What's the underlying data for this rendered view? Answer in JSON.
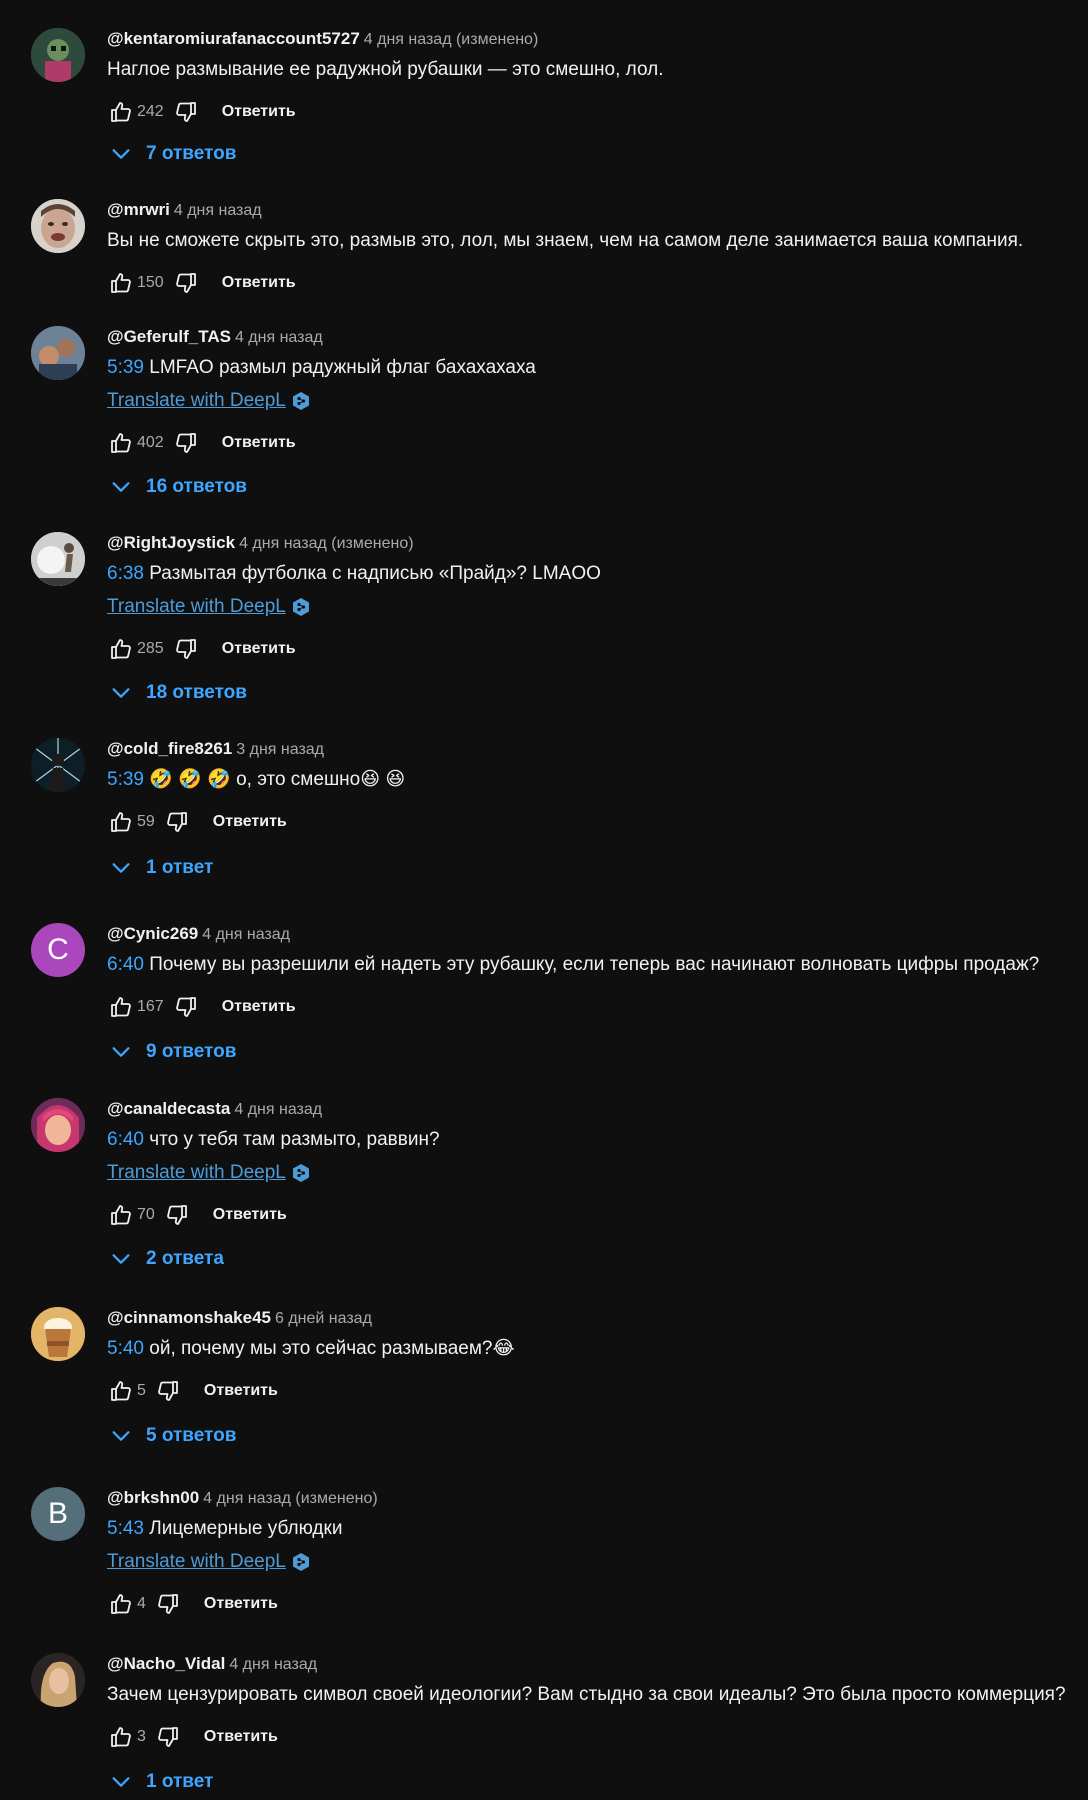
{
  "labels": {
    "reply": "Ответить",
    "translate": "Translate with DeepL"
  },
  "comments": [
    {
      "author": "@kentaromiurafanaccount5727",
      "meta": "4 дня назад (изменено)",
      "timestamp": "",
      "text": "Наглое размывание ее радужной рубашки — это смешно, лол.",
      "likes": "242",
      "replies": "7 ответов",
      "avatar": {
        "color": "#3b5e3a",
        "letter": "",
        "icon": "cartoon-avatar"
      }
    },
    {
      "author": "@mrwri",
      "meta": "4 дня назад",
      "timestamp": "",
      "text": "Вы не сможете скрыть это, размыв это, лол, мы знаем, чем на самом деле занимается ваша компания.",
      "likes": "150",
      "replies": "",
      "avatar": {
        "color": "#b59a8c",
        "letter": "",
        "icon": "face-avatar"
      }
    },
    {
      "author": "@Geferulf_TAS",
      "meta": "4 дня назад",
      "timestamp": "5:39",
      "text": "LMFAO размыл радужный флаг бахахахаха",
      "likes": "402",
      "replies": "16 ответов",
      "avatar": {
        "color": "#556a7e",
        "letter": "",
        "icon": "photo-avatar"
      }
    },
    {
      "author": "@RightJoystick",
      "meta": "4 дня назад (изменено)",
      "timestamp": "6:38",
      "text": "Размытая футболка с надписью «Прайд»? LMAOO",
      "likes": "285",
      "replies": "18 ответов",
      "avatar": {
        "color": "#9a9a9a",
        "letter": "",
        "icon": "figure-avatar"
      }
    },
    {
      "author": "@cold_fire8261",
      "meta": "3 дня назад",
      "timestamp": "5:39",
      "text": "🤣 🤣 🤣 о, это смешно😆 😆",
      "likes": "59",
      "replies": "1 ответ",
      "avatar": {
        "color": "#16303c",
        "letter": "",
        "icon": "dark-figure-avatar"
      }
    },
    {
      "author": "@Cynic269",
      "meta": "4 дня назад",
      "timestamp": "6:40",
      "text": "Почему вы разрешили ей надеть эту рубашку, если теперь вас начинают волновать цифры продаж?",
      "likes": "167",
      "replies": "9 ответов",
      "avatar": {
        "color": "#ab47bc",
        "letter": "C",
        "icon": "letter-avatar"
      }
    },
    {
      "author": "@canaldecasta",
      "meta": "4 дня назад",
      "timestamp": "6:40",
      "text": "что у тебя там размыто, раввин?",
      "likes": "70",
      "replies": "2 ответа",
      "avatar": {
        "color": "#8a3c6e",
        "letter": "",
        "icon": "anime-avatar"
      }
    },
    {
      "author": "@cinnamonshake45",
      "meta": "6 дней назад",
      "timestamp": "5:40",
      "text": "ой, почему мы это сейчас размываем?😂",
      "likes": "5",
      "replies": "5 ответов",
      "avatar": {
        "color": "#c9953e",
        "letter": "",
        "icon": "drink-avatar"
      }
    },
    {
      "author": "@brkshn00",
      "meta": "4 дня назад (изменено)",
      "timestamp": "5:43",
      "text": "Лицемерные ублюдки",
      "likes": "4",
      "replies": "",
      "avatar": {
        "color": "#546e7a",
        "letter": "B",
        "icon": "letter-avatar"
      }
    },
    {
      "author": "@Nacho_Vidal",
      "meta": "4 дня назад",
      "timestamp": "",
      "text": "Зачем цензурировать символ своей идеологии? Вам стыдно за свои идеалы? Это была просто коммерция?",
      "likes": "3",
      "replies": "1 ответ",
      "avatar": {
        "color": "#3a3030",
        "letter": "",
        "icon": "portrait-avatar"
      }
    }
  ]
}
